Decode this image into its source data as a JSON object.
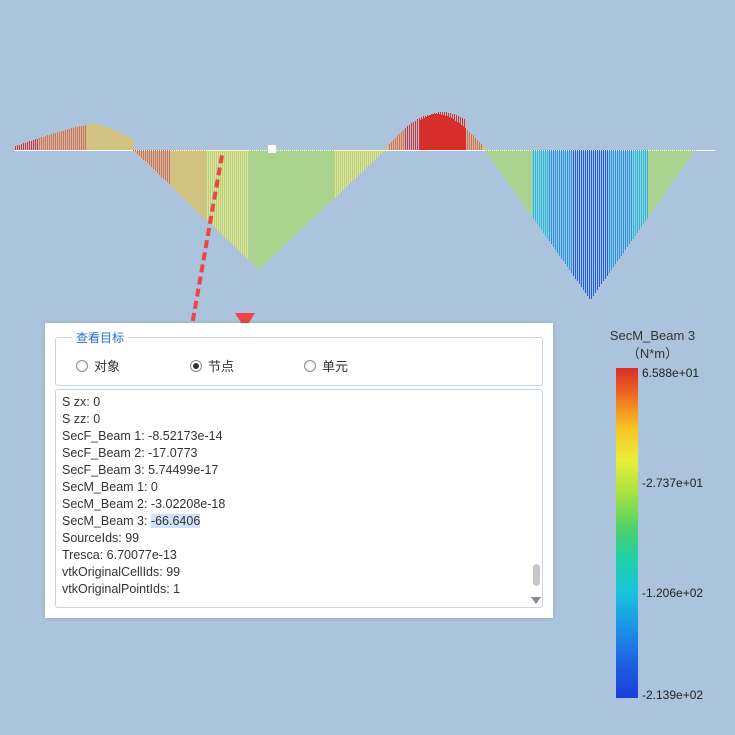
{
  "panel": {
    "legend_title": "查看目标",
    "options": [
      {
        "label": "对象",
        "selected": false
      },
      {
        "label": "节点",
        "selected": true
      },
      {
        "label": "单元",
        "selected": false
      }
    ],
    "rows": [
      "S zx: 0",
      "S zz: 0",
      "SecF_Beam 1: -8.52173e-14",
      "SecF_Beam 2: -17.0773",
      "SecF_Beam 3: 5.74499e-17",
      "SecM_Beam 1: 0",
      "SecM_Beam 2: -3.02208e-18",
      "",
      "SourceIds: 99",
      "Tresca: 6.70077e-13",
      "vtkOriginalCellIds: 99",
      "vtkOriginalPointIds: 1"
    ],
    "highlight_row": {
      "prefix": "SecM_Beam 3: ",
      "value": "-66.6406"
    }
  },
  "colorbar": {
    "title_line1": "SecM_Beam 3",
    "title_line2": "（N*m）",
    "ticks": [
      {
        "label": "6.588e+01",
        "pos": 0
      },
      {
        "label": "-2.737e+01",
        "pos": 110
      },
      {
        "label": "-1.206e+02",
        "pos": 220
      },
      {
        "label": "-2.139e+02",
        "pos": 322
      }
    ]
  }
}
